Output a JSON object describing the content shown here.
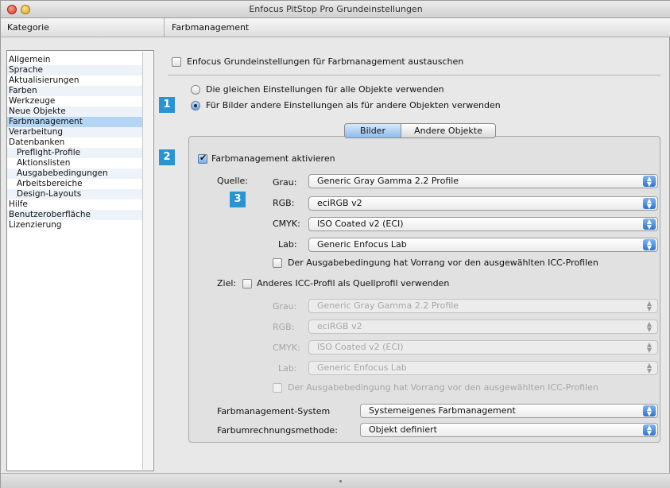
{
  "window": {
    "title": "Enfocus PitStop Pro Grundeinstellungen"
  },
  "headers": {
    "kategorie": "Kategorie",
    "section": "Farbmanagement"
  },
  "sidebar": {
    "items": [
      {
        "label": "Allgemein"
      },
      {
        "label": "Sprache"
      },
      {
        "label": "Aktualisierungen"
      },
      {
        "label": "Farben"
      },
      {
        "label": "Werkzeuge"
      },
      {
        "label": "Neue Objekte"
      },
      {
        "label": "Farbmanagement"
      },
      {
        "label": "Verarbeitung"
      },
      {
        "label": "Datenbanken"
      },
      {
        "label": "Preflight-Profile"
      },
      {
        "label": "Aktionslisten"
      },
      {
        "label": "Ausgabebedingungen"
      },
      {
        "label": "Arbeitsbereiche"
      },
      {
        "label": "Design-Layouts"
      },
      {
        "label": "Hilfe"
      },
      {
        "label": "Benutzeroberfläche"
      },
      {
        "label": "Lizenzierung"
      }
    ],
    "selected": "Farbmanagement"
  },
  "main": {
    "replace_checkbox": {
      "label": "Enfocus Grundeinstellungen für Farbmanagement austauschen",
      "checked": false
    },
    "radio_same": {
      "label": "Die gleichen Einstellungen für alle Objekte verwenden",
      "selected": false
    },
    "radio_different": {
      "label": "Für Bilder andere Einstellungen als für andere Objekten verwenden",
      "selected": true
    },
    "tabs": {
      "bilder": "Bilder",
      "andere": "Andere Objekte",
      "active": "Bilder"
    },
    "activate": {
      "label": "Farbmanagement aktivieren",
      "checked": true
    },
    "quelle": {
      "label": "Quelle:",
      "grau": {
        "label": "Grau:",
        "value": "Generic Gray Gamma 2.2 Profile"
      },
      "rgb": {
        "label": "RGB:",
        "value": "eciRGB v2"
      },
      "cmyk": {
        "label": "CMYK:",
        "value": "ISO Coated v2 (ECI)"
      },
      "lab": {
        "label": "Lab:",
        "value": "Generic Enfocus Lab"
      },
      "priority": {
        "label": "Der Ausgabebedingung hat Vorrang vor den ausgewählten ICC-Profilen",
        "checked": false
      }
    },
    "ziel": {
      "label": "Ziel:",
      "other_profile": {
        "label": "Anderes ICC-Profil als Quellprofil verwenden",
        "checked": false
      },
      "grau": {
        "label": "Grau:",
        "value": "Generic Gray Gamma 2.2 Profile"
      },
      "rgb": {
        "label": "RGB:",
        "value": "eciRGB v2"
      },
      "cmyk": {
        "label": "CMYK:",
        "value": "ISO Coated v2 (ECI)"
      },
      "lab": {
        "label": "Lab:",
        "value": "Generic Enfocus Lab"
      },
      "priority": {
        "label": "Der Ausgabebedingung hat Vorrang vor den ausgewählten ICC-Profilen",
        "checked": false
      }
    },
    "system": {
      "label": "Farbmanagement-System",
      "value": "Systemeigenes Farbmanagement"
    },
    "method": {
      "label": "Farbumrechnungsmethode:",
      "value": "Objekt definiert"
    }
  },
  "badges": [
    "1",
    "2",
    "3"
  ],
  "colors": {
    "badge": "#2a93d4",
    "selection": "#b5d5f5",
    "popup_arrow": "#2f74d0"
  }
}
